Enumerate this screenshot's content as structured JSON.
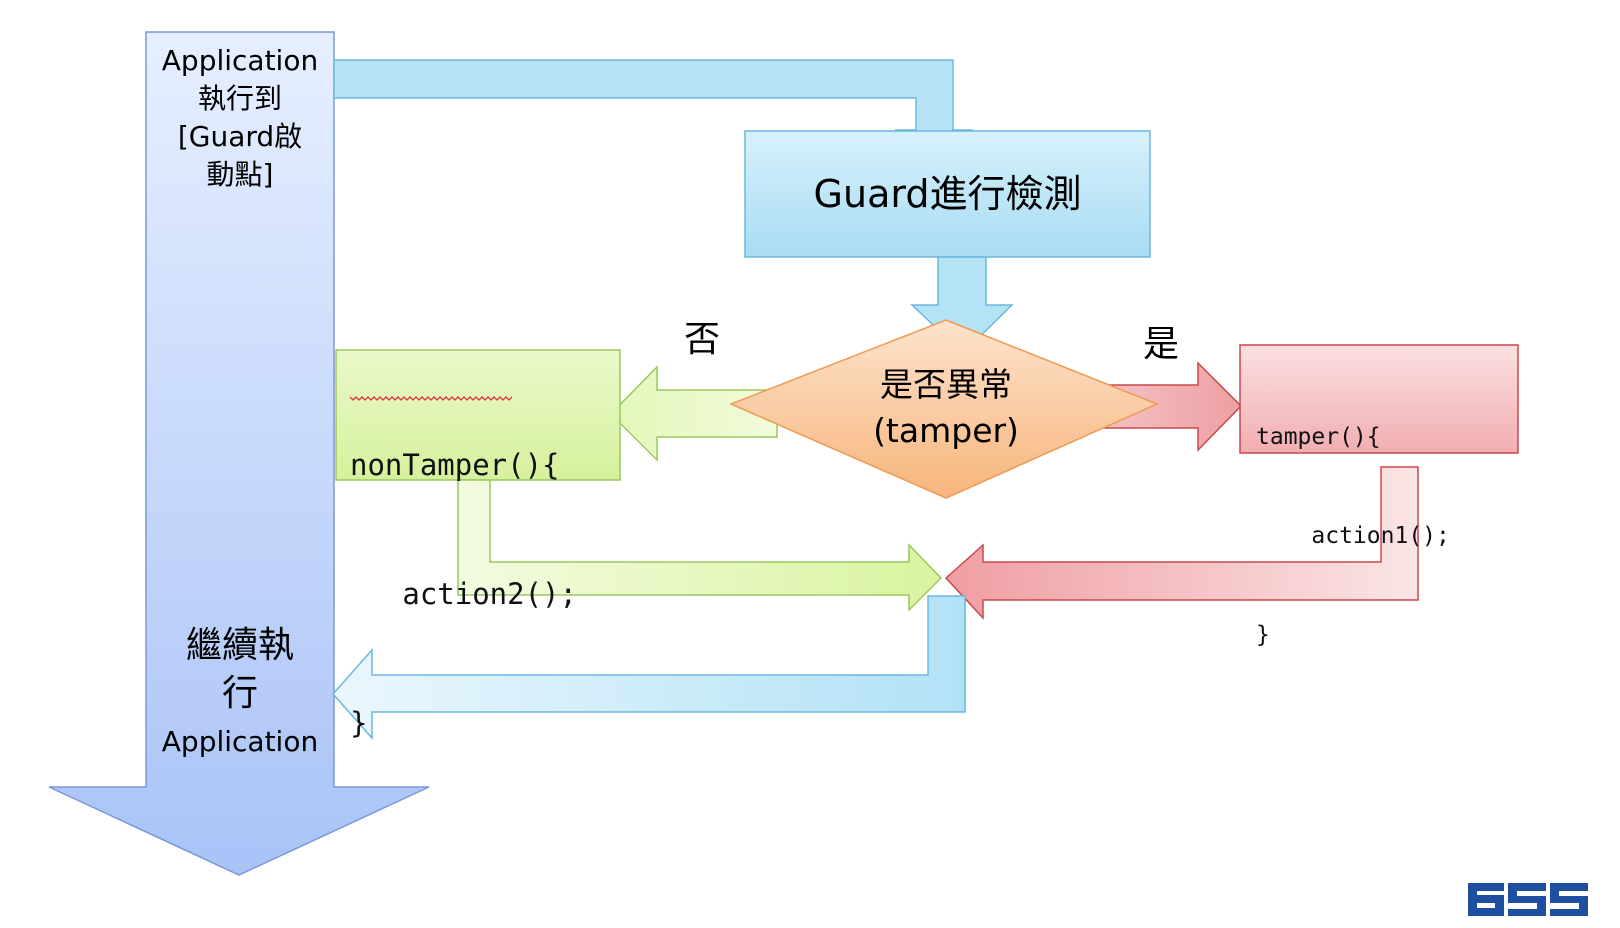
{
  "app_start": {
    "lines": [
      "Application",
      "執行到",
      "[Guard啟",
      "動點]"
    ]
  },
  "app_continue": {
    "lines": [
      "繼續執",
      "行",
      "Application"
    ]
  },
  "guard_box": {
    "label": "Guard進行檢測"
  },
  "decision": {
    "line1": "是否異常",
    "line2": "(tamper)"
  },
  "branch_no": {
    "label": "否"
  },
  "branch_yes": {
    "label": "是"
  },
  "non_tamper_code": {
    "lines": [
      "nonTamper(){",
      "   action2();",
      "}"
    ]
  },
  "tamper_code": {
    "lines": [
      "tamper(){",
      "    action1();",
      "}"
    ]
  },
  "logo": {
    "text": "GSS"
  },
  "colors": {
    "blue": "#b9e4f7",
    "blue_stroke": "#6bb8dd",
    "green": "#dcf5a8",
    "green_stroke": "#9ac85e",
    "red": "#f2b4b6",
    "red_stroke": "#c8484c",
    "orange": "#f9c497",
    "orange_stroke": "#ee9a52",
    "main_arrow": "#a9c6f8",
    "main_arrow_stroke": "#7a98d8",
    "logo": "#1f4fa0"
  }
}
